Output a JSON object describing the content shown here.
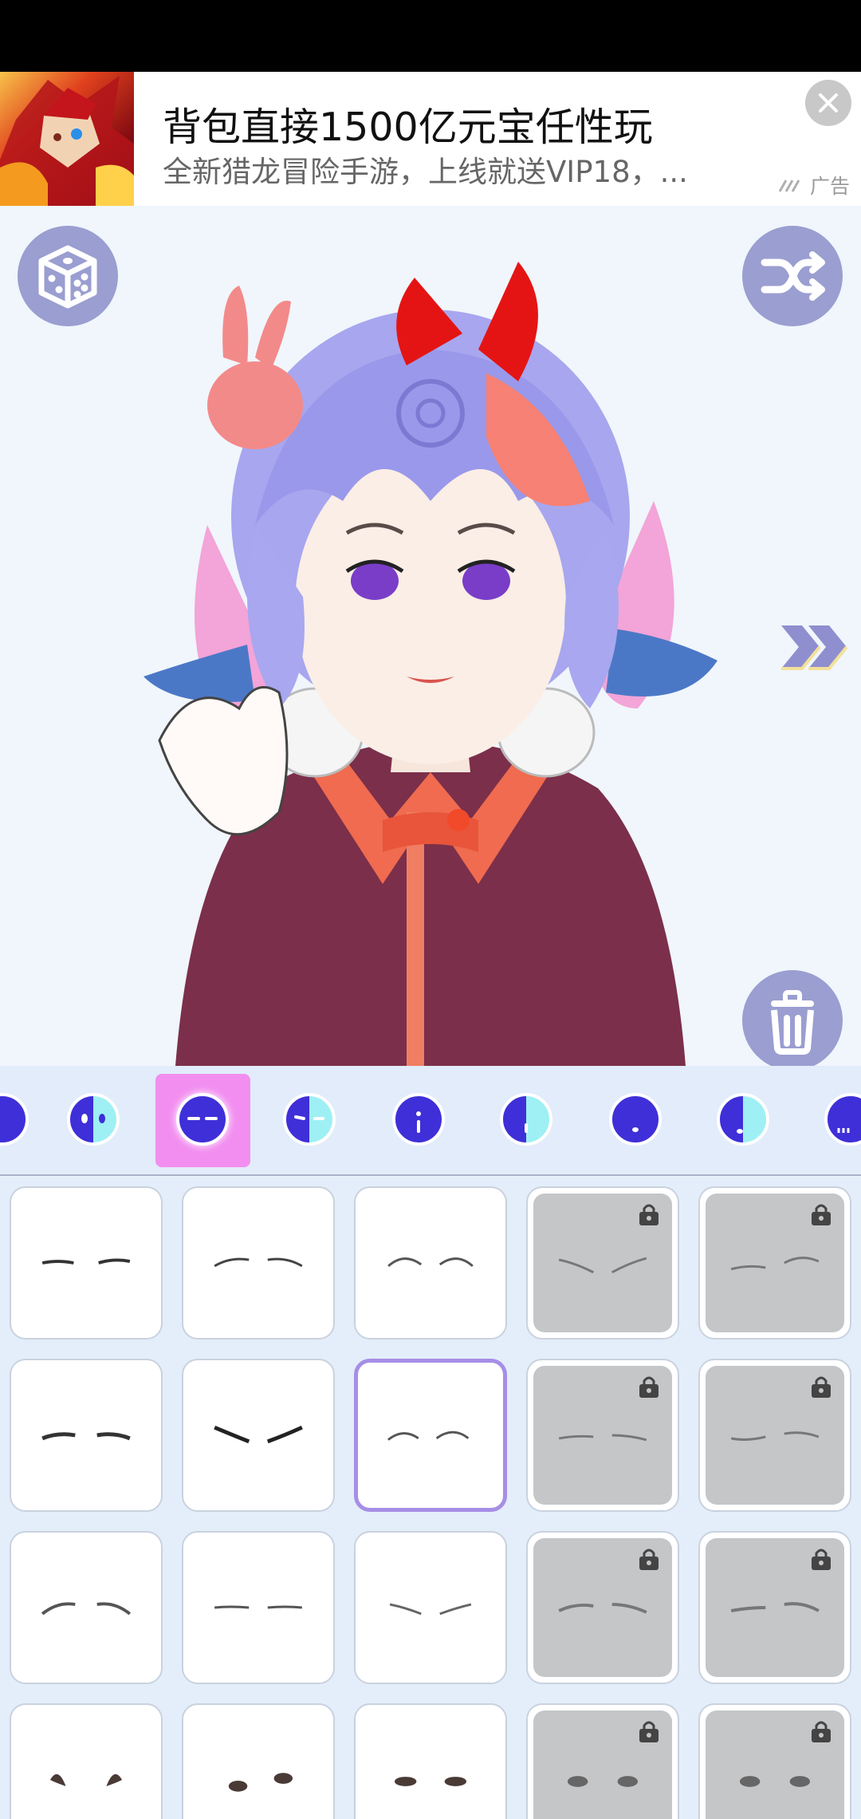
{
  "ad": {
    "title": "背包直接1500亿元宝任性玩",
    "description": "全新猎龙冒险手游，上线就送VIP18，...",
    "label": "广告",
    "close_icon": "close-icon"
  },
  "stage": {
    "random_dice_icon": "dice-icon",
    "shuffle_icon": "shuffle-icon",
    "next_icon": "double-chevron-right-icon",
    "delete_icon": "trash-icon"
  },
  "toolbar": {
    "categories": [
      {
        "name": "eyes-full"
      },
      {
        "name": "eyes-half"
      },
      {
        "name": "eyes-glow",
        "selected": true
      },
      {
        "name": "eyes-half-lines"
      },
      {
        "name": "nose"
      },
      {
        "name": "nose-half"
      },
      {
        "name": "mouth"
      },
      {
        "name": "mouth-half"
      },
      {
        "name": "more"
      }
    ]
  },
  "grid": {
    "items": [
      {
        "style": "flat",
        "locked": false
      },
      {
        "style": "arched-thin",
        "locked": false
      },
      {
        "style": "arched-high",
        "locked": false
      },
      {
        "style": "angry",
        "locked": true
      },
      {
        "style": "uneven",
        "locked": true
      },
      {
        "style": "thick-flat",
        "locked": false
      },
      {
        "style": "sharp-down",
        "locked": false
      },
      {
        "style": "soft-arch",
        "locked": false,
        "selected": true
      },
      {
        "style": "thin-flat",
        "locked": true
      },
      {
        "style": "thin-uneven",
        "locked": true
      },
      {
        "style": "round-arch",
        "locked": false
      },
      {
        "style": "straight-thin",
        "locked": false
      },
      {
        "style": "slanted-thin",
        "locked": false
      },
      {
        "style": "faded-arch",
        "locked": true
      },
      {
        "style": "faded-uneven",
        "locked": true
      },
      {
        "style": "tuft",
        "locked": false
      },
      {
        "style": "dots",
        "locked": false
      },
      {
        "style": "oval-dots",
        "locked": false
      },
      {
        "style": "oval-dots-gray",
        "locked": true
      },
      {
        "style": "oval-dots-gray-2",
        "locked": true
      }
    ]
  },
  "colors": {
    "accent": "#9a9ed0",
    "selected_tab": "#f28ef0",
    "selected_outline": "#a78ee6",
    "icon_blue": "#3f2fd8"
  }
}
